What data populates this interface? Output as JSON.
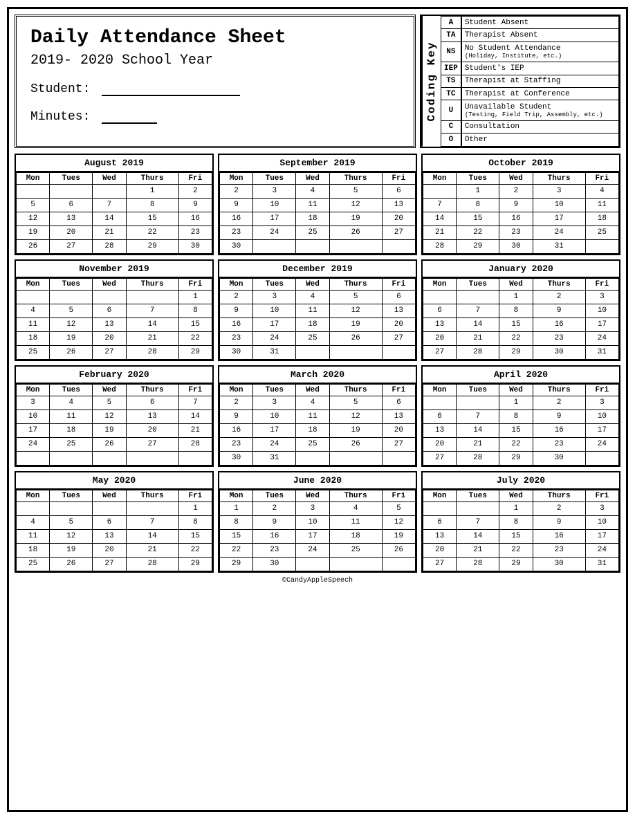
{
  "header": {
    "title": "Daily Attendance Sheet",
    "year": "2019- 2020 School Year",
    "student_label": "Student:",
    "minutes_label": "Minutes:"
  },
  "coding_key_label": "Coding Key",
  "coding_key": [
    {
      "code": "A",
      "description": "Student Absent",
      "sub": ""
    },
    {
      "code": "TA",
      "description": "Therapist Absent",
      "sub": ""
    },
    {
      "code": "NS",
      "description": "No Student Attendance",
      "sub": "(Holiday, Institute, etc.)"
    },
    {
      "code": "IEP",
      "description": "Student's IEP",
      "sub": ""
    },
    {
      "code": "TS",
      "description": "Therapist at Staffing",
      "sub": ""
    },
    {
      "code": "TC",
      "description": "Therapist at Conference",
      "sub": ""
    },
    {
      "code": "U",
      "description": "Unavailable Student",
      "sub": "(Testing, Field Trip, Assembly, etc.)"
    },
    {
      "code": "C",
      "description": "Consultation",
      "sub": ""
    },
    {
      "code": "O",
      "description": "Other",
      "sub": ""
    }
  ],
  "days": [
    "Mon",
    "Tues",
    "Wed",
    "Thurs",
    "Fri"
  ],
  "calendars": [
    {
      "title": "August 2019",
      "weeks": [
        [
          "",
          "",
          "",
          "1",
          "2"
        ],
        [
          "5",
          "6",
          "7",
          "8",
          "9"
        ],
        [
          "12",
          "13",
          "14",
          "15",
          "16"
        ],
        [
          "19",
          "20",
          "21",
          "22",
          "23"
        ],
        [
          "26",
          "27",
          "28",
          "29",
          "30"
        ]
      ]
    },
    {
      "title": "September 2019",
      "weeks": [
        [
          "2",
          "3",
          "4",
          "5",
          "6"
        ],
        [
          "9",
          "10",
          "11",
          "12",
          "13"
        ],
        [
          "16",
          "17",
          "18",
          "19",
          "20"
        ],
        [
          "23",
          "24",
          "25",
          "26",
          "27"
        ],
        [
          "30",
          "",
          "",
          "",
          ""
        ]
      ]
    },
    {
      "title": "October 2019",
      "weeks": [
        [
          "",
          "1",
          "2",
          "3",
          "4"
        ],
        [
          "7",
          "8",
          "9",
          "10",
          "11"
        ],
        [
          "14",
          "15",
          "16",
          "17",
          "18"
        ],
        [
          "21",
          "22",
          "23",
          "24",
          "25"
        ],
        [
          "28",
          "29",
          "30",
          "31",
          ""
        ]
      ]
    },
    {
      "title": "November 2019",
      "weeks": [
        [
          "",
          "",
          "",
          "",
          "1"
        ],
        [
          "4",
          "5",
          "6",
          "7",
          "8"
        ],
        [
          "11",
          "12",
          "13",
          "14",
          "15"
        ],
        [
          "18",
          "19",
          "20",
          "21",
          "22"
        ],
        [
          "25",
          "26",
          "27",
          "28",
          "29"
        ]
      ]
    },
    {
      "title": "December 2019",
      "weeks": [
        [
          "2",
          "3",
          "4",
          "5",
          "6"
        ],
        [
          "9",
          "10",
          "11",
          "12",
          "13"
        ],
        [
          "16",
          "17",
          "18",
          "19",
          "20"
        ],
        [
          "23",
          "24",
          "25",
          "26",
          "27"
        ],
        [
          "30",
          "31",
          "",
          "",
          ""
        ]
      ]
    },
    {
      "title": "January 2020",
      "weeks": [
        [
          "",
          "",
          "1",
          "2",
          "3"
        ],
        [
          "6",
          "7",
          "8",
          "9",
          "10"
        ],
        [
          "13",
          "14",
          "15",
          "16",
          "17"
        ],
        [
          "20",
          "21",
          "22",
          "23",
          "24"
        ],
        [
          "27",
          "28",
          "29",
          "30",
          "31"
        ]
      ]
    },
    {
      "title": "February 2020",
      "weeks": [
        [
          "3",
          "4",
          "5",
          "6",
          "7"
        ],
        [
          "10",
          "11",
          "12",
          "13",
          "14"
        ],
        [
          "17",
          "18",
          "19",
          "20",
          "21"
        ],
        [
          "24",
          "25",
          "26",
          "27",
          "28"
        ],
        [
          "",
          "",
          "",
          "",
          ""
        ]
      ]
    },
    {
      "title": "March 2020",
      "weeks": [
        [
          "2",
          "3",
          "4",
          "5",
          "6"
        ],
        [
          "9",
          "10",
          "11",
          "12",
          "13"
        ],
        [
          "16",
          "17",
          "18",
          "19",
          "20"
        ],
        [
          "23",
          "24",
          "25",
          "26",
          "27"
        ],
        [
          "30",
          "31",
          "",
          "",
          ""
        ]
      ]
    },
    {
      "title": "April 2020",
      "weeks": [
        [
          "",
          "",
          "1",
          "2",
          "3"
        ],
        [
          "6",
          "7",
          "8",
          "9",
          "10"
        ],
        [
          "13",
          "14",
          "15",
          "16",
          "17"
        ],
        [
          "20",
          "21",
          "22",
          "23",
          "24"
        ],
        [
          "27",
          "28",
          "29",
          "30",
          ""
        ]
      ]
    },
    {
      "title": "May 2020",
      "weeks": [
        [
          "",
          "",
          "",
          "",
          "1"
        ],
        [
          "4",
          "5",
          "6",
          "7",
          "8"
        ],
        [
          "11",
          "12",
          "13",
          "14",
          "15"
        ],
        [
          "18",
          "19",
          "20",
          "21",
          "22"
        ],
        [
          "25",
          "26",
          "27",
          "28",
          "29"
        ]
      ]
    },
    {
      "title": "June 2020",
      "weeks": [
        [
          "1",
          "2",
          "3",
          "4",
          "5"
        ],
        [
          "8",
          "9",
          "10",
          "11",
          "12"
        ],
        [
          "15",
          "16",
          "17",
          "18",
          "19"
        ],
        [
          "22",
          "23",
          "24",
          "25",
          "26"
        ],
        [
          "29",
          "30",
          "",
          "",
          ""
        ]
      ]
    },
    {
      "title": "July 2020",
      "weeks": [
        [
          "",
          "",
          "1",
          "2",
          "3"
        ],
        [
          "6",
          "7",
          "8",
          "9",
          "10"
        ],
        [
          "13",
          "14",
          "15",
          "16",
          "17"
        ],
        [
          "20",
          "21",
          "22",
          "23",
          "24"
        ],
        [
          "27",
          "28",
          "29",
          "30",
          "31"
        ]
      ]
    }
  ],
  "copyright": "©CandyAppleSpeech"
}
